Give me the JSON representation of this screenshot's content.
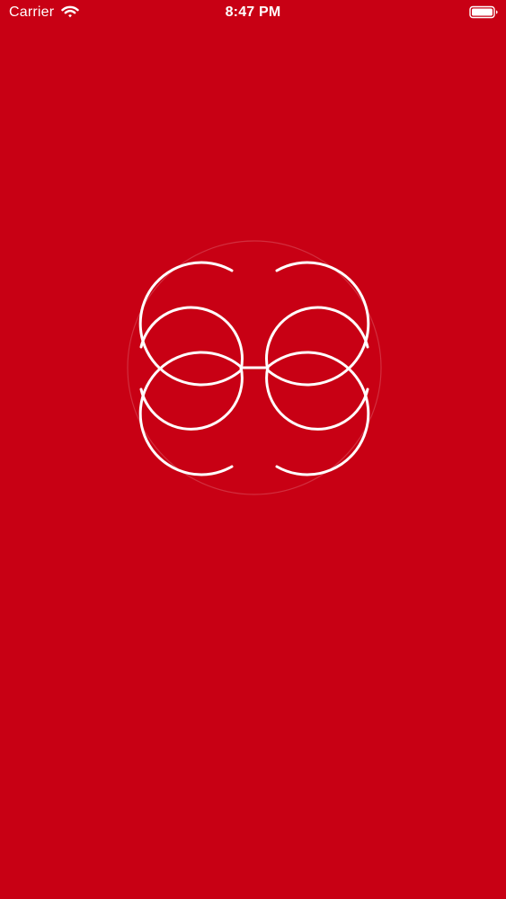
{
  "screen": {
    "background_color": "#c80014",
    "foreground_color": "#ffffff"
  },
  "status_bar": {
    "carrier": "Carrier",
    "time": "8:47 PM",
    "wifi_icon": "wifi-icon",
    "battery_icon": "battery-icon"
  },
  "splash": {
    "logo_icon": "interlocking-circles-logo-icon"
  }
}
